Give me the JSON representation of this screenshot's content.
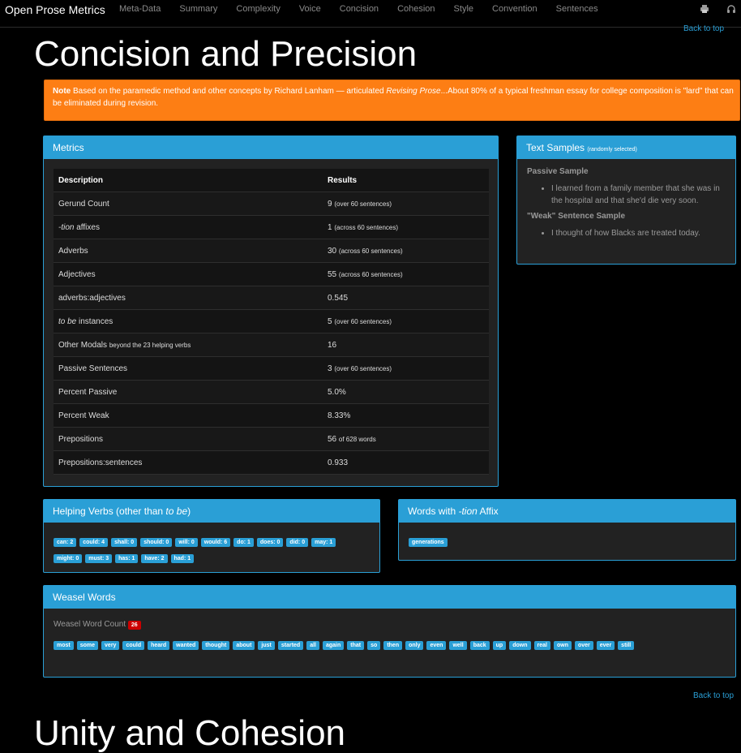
{
  "navbar": {
    "brand": "Open Prose Metrics",
    "items": [
      "Meta-Data",
      "Summary",
      "Complexity",
      "Voice",
      "Concision",
      "Cohesion",
      "Style",
      "Convention",
      "Sentences"
    ],
    "icons": [
      "print-icon",
      "headphones-icon"
    ]
  },
  "back_to_top": "Back to top",
  "section": {
    "title": "Concision and Precision",
    "next_title": "Unity and Cohesion"
  },
  "note": {
    "strong": "Note",
    "text1": " Based on the paramedic method and other concepts by Richard Lanham — articulated ",
    "em": "Revising Prose",
    "text2": "...About 80% of a typical freshman essay for college composition is \"lard\" that can be eliminated during revision."
  },
  "metrics": {
    "title": "Metrics",
    "headers": [
      "Description",
      "Results"
    ],
    "rows": [
      {
        "desc": "Gerund Count",
        "desc_em": "",
        "desc_small": "",
        "value": "9",
        "note": "(over 60 sentences)"
      },
      {
        "desc": " affixes",
        "desc_em": "-tion",
        "desc_small": "",
        "value": "1",
        "note": "(across 60 sentences)"
      },
      {
        "desc": "Adverbs",
        "desc_em": "",
        "desc_small": "",
        "value": "30",
        "note": "(across 60 sentences)"
      },
      {
        "desc": "Adjectives",
        "desc_em": "",
        "desc_small": "",
        "value": "55",
        "note": "(across 60 sentences)"
      },
      {
        "desc": "adverbs:adjectives",
        "desc_em": "",
        "desc_small": "",
        "value": "0.545",
        "note": ""
      },
      {
        "desc": " instances",
        "desc_em": "to be",
        "desc_small": "",
        "value": "5",
        "note": "(over 60 sentences)"
      },
      {
        "desc": "Other Modals ",
        "desc_em": "",
        "desc_small": "beyond the 23 helping verbs",
        "value": "16",
        "note": ""
      },
      {
        "desc": "Passive Sentences",
        "desc_em": "",
        "desc_small": "",
        "value": "3",
        "note": "(over 60 sentences)"
      },
      {
        "desc": "Percent Passive",
        "desc_em": "",
        "desc_small": "",
        "value": "5.0%",
        "note": ""
      },
      {
        "desc": "Percent Weak",
        "desc_em": "",
        "desc_small": "",
        "value": "8.33%",
        "note": ""
      },
      {
        "desc": "Prepositions",
        "desc_em": "",
        "desc_small": "",
        "value": "56",
        "note": "of 628 words"
      },
      {
        "desc": "Prepositions:sentences",
        "desc_em": "",
        "desc_small": "",
        "value": "0.933",
        "note": ""
      }
    ]
  },
  "samples": {
    "title": "Text Samples",
    "title_small": "(randomly selected)",
    "passive_heading": "Passive Sample",
    "passive_text": "I learned from a family member that she was in the hospital and that she'd die very soon.",
    "weak_heading": "\"Weak\" Sentence Sample",
    "weak_text": "I thought of how Blacks are treated today."
  },
  "helping": {
    "title_pre": "Helping Verbs (other than ",
    "title_em": "to be",
    "title_post": ")",
    "labels": [
      "can: 2",
      "could: 4",
      "shall: 0",
      "should: 0",
      "will: 0",
      "would: 6",
      "do: 1",
      "does: 0",
      "did: 0",
      "may: 1",
      "might: 0",
      "must: 3",
      "has: 1",
      "have: 2",
      "had: 1"
    ]
  },
  "tion": {
    "title_pre": "Words with ",
    "title_em": "-tion",
    "title_post": " Affix",
    "labels": [
      "generations"
    ]
  },
  "weasel": {
    "title": "Weasel Words",
    "count_label": "Weasel Word Count",
    "count": "26",
    "labels": [
      "most",
      "some",
      "very",
      "could",
      "heard",
      "wanted",
      "thought",
      "about",
      "just",
      "started",
      "all",
      "again",
      "that",
      "so",
      "then",
      "only",
      "even",
      "well",
      "back",
      "up",
      "down",
      "real",
      "own",
      "over",
      "ever",
      "still"
    ]
  },
  "colors": {
    "accent": "#2a9fd6",
    "warning": "#fd7e14",
    "danger": "#cc0000"
  }
}
